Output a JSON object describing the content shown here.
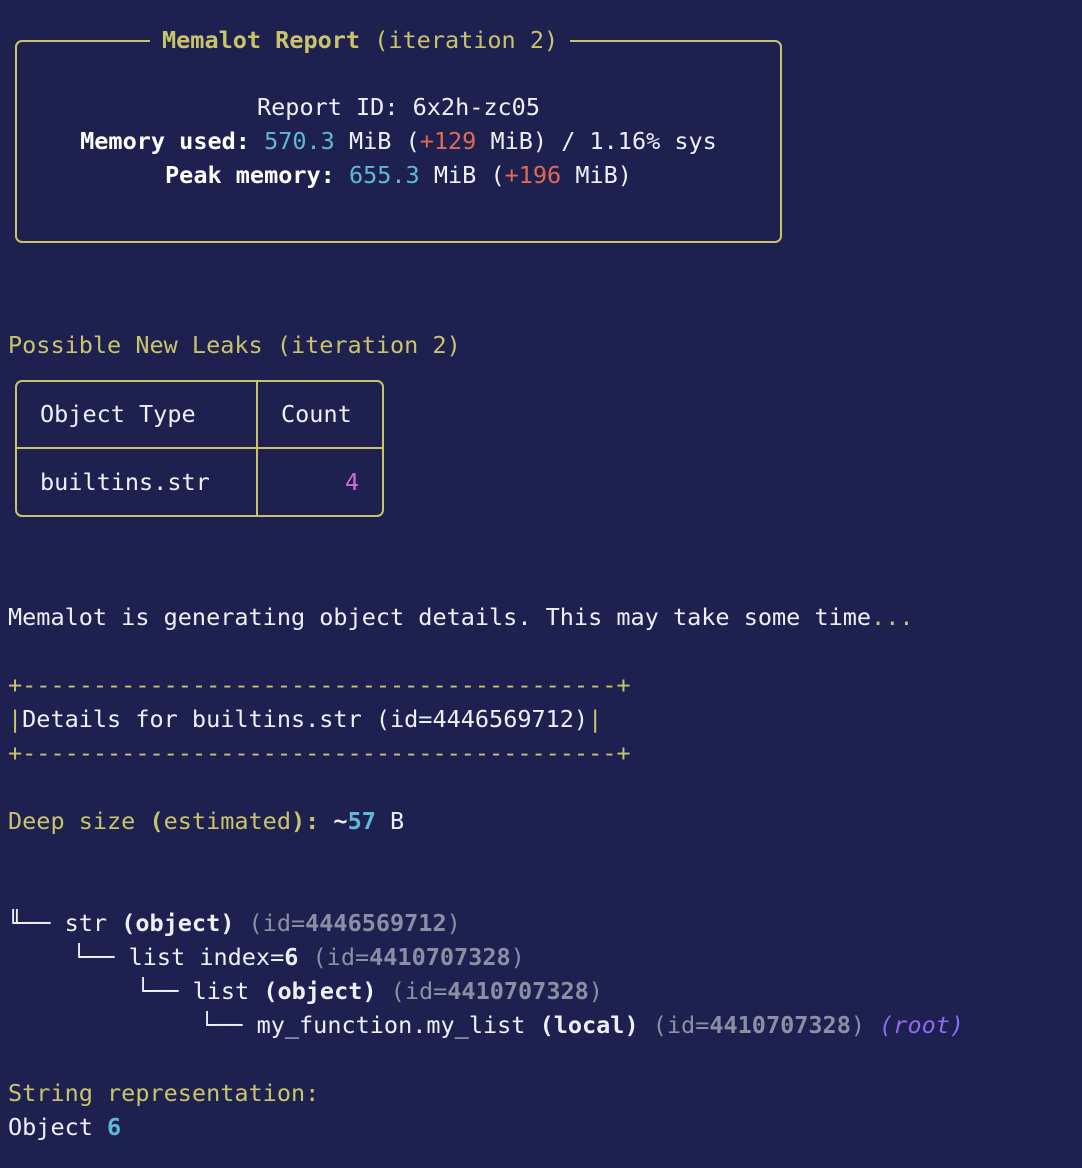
{
  "report": {
    "title_main": "Memalot Report",
    "title_suffix": " (iteration 2)",
    "id_label": "Report ID: ",
    "id_value": "6x2h-zc05",
    "mem_label": "Memory used:",
    "mem_value": "570.3",
    "mem_unit": " MiB (",
    "mem_delta": "+129",
    "mem_rest": " MiB) / 1.16% sys",
    "peak_label": "Peak memory:",
    "peak_value": "655.3",
    "peak_unit": " MiB (",
    "peak_delta": "+196",
    "peak_rest": " MiB)"
  },
  "leaks": {
    "heading": "Possible New Leaks (iteration 2)",
    "columns": [
      "Object Type",
      "Count"
    ],
    "rows": [
      {
        "type": "builtins.str",
        "count": "4"
      }
    ]
  },
  "generating": {
    "text": "Memalot is generating object details. This may take some time",
    "dots": "..."
  },
  "details": {
    "border": "+------------------------------------------+",
    "pipe": "|",
    "title": "Details for builtins.str (id=4446569712)"
  },
  "deep_size": {
    "label": "Deep size ",
    "paren_open": "(",
    "estimated": "estimated",
    "paren_close": "):",
    "tilde": " ~",
    "value": "57",
    "unit": " B"
  },
  "tree": {
    "n1": {
      "prefix": "╙── ",
      "name": "str ",
      "kind": "(object)",
      "id_open": " (id=",
      "id": "4446569712",
      "id_close": ")"
    },
    "n2": {
      "prefix": "└── ",
      "name": "list index=",
      "index": "6",
      "id_open": " (id=",
      "id": "4410707328",
      "id_close": ")"
    },
    "n3": {
      "prefix": "└── ",
      "name": "list ",
      "kind": "(object)",
      "id_open": " (id=",
      "id": "4410707328",
      "id_close": ")"
    },
    "n4": {
      "prefix": "└── ",
      "name": "my_function.my_list ",
      "kind": "(local)",
      "id_open": " (id=",
      "id": "4410707328",
      "id_close": ")",
      "root": " (root)"
    }
  },
  "string_repr": {
    "label": "String representation:",
    "value_word": "Object ",
    "value_num": "6"
  },
  "colors": {
    "background": "#1e2150",
    "accent_yellow": "#c9c46a",
    "number_blue": "#5fb8d8",
    "delta_red": "#e06a52",
    "count_magenta": "#d36ad6",
    "root_violet": "#8a6cf0"
  }
}
